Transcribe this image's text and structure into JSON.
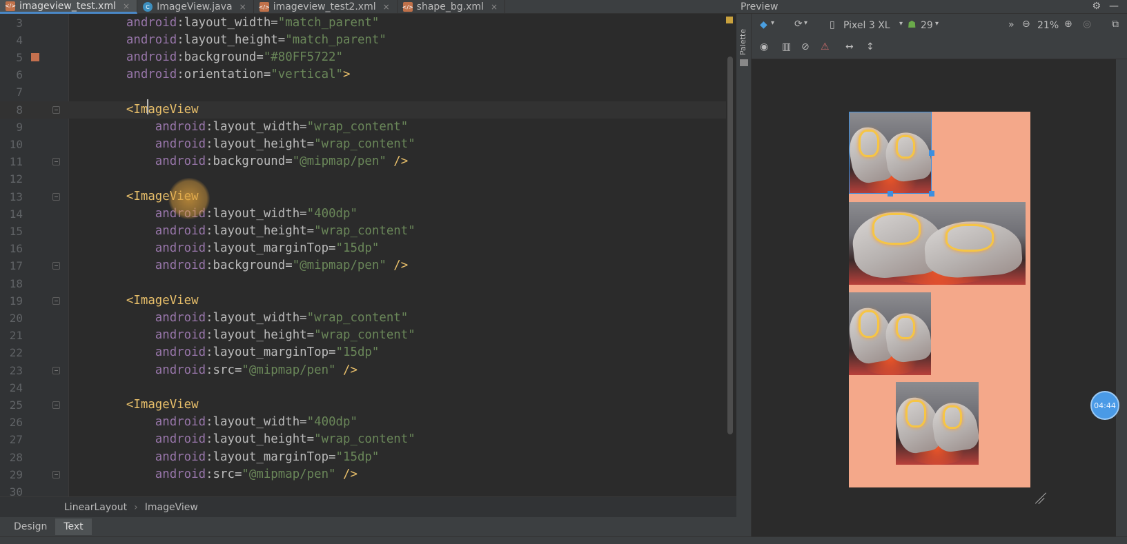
{
  "tabs": [
    {
      "label": "imageview_test.xml",
      "icon": "xml-file-icon",
      "active": true
    },
    {
      "label": "ImageView.java",
      "icon": "java-class-icon",
      "active": false
    },
    {
      "label": "imageview_test2.xml",
      "icon": "xml-file-icon",
      "active": false
    },
    {
      "label": "shape_bg.xml",
      "icon": "xml-file-icon",
      "active": false
    }
  ],
  "editor": {
    "lines": [
      {
        "num": "3",
        "indent": "    ",
        "parts": [
          {
            "c": "ns",
            "t": "android"
          },
          {
            "c": "attr",
            "t": ":layout_width="
          },
          {
            "c": "val",
            "t": "\"match_parent\""
          }
        ]
      },
      {
        "num": "4",
        "indent": "    ",
        "parts": [
          {
            "c": "ns",
            "t": "android"
          },
          {
            "c": "attr",
            "t": ":layout_height="
          },
          {
            "c": "val",
            "t": "\"match_parent\""
          }
        ]
      },
      {
        "num": "5",
        "indent": "    ",
        "parts": [
          {
            "c": "ns",
            "t": "android"
          },
          {
            "c": "attr",
            "t": ":background="
          },
          {
            "c": "val",
            "t": "\"#80FF5722\""
          }
        ]
      },
      {
        "num": "6",
        "indent": "    ",
        "parts": [
          {
            "c": "ns",
            "t": "android"
          },
          {
            "c": "attr",
            "t": ":orientation="
          },
          {
            "c": "val",
            "t": "\"vertical\""
          },
          {
            "c": "punct",
            "t": ">"
          }
        ]
      },
      {
        "num": "7",
        "indent": "",
        "parts": []
      },
      {
        "num": "8",
        "indent": "    ",
        "parts": [
          {
            "c": "punct",
            "t": "<"
          },
          {
            "c": "tag",
            "t": "ImageView"
          }
        ]
      },
      {
        "num": "9",
        "indent": "        ",
        "parts": [
          {
            "c": "ns",
            "t": "android"
          },
          {
            "c": "attr",
            "t": ":layout_width="
          },
          {
            "c": "val",
            "t": "\"wrap_content\""
          }
        ]
      },
      {
        "num": "10",
        "indent": "        ",
        "parts": [
          {
            "c": "ns",
            "t": "android"
          },
          {
            "c": "attr",
            "t": ":layout_height="
          },
          {
            "c": "val",
            "t": "\"wrap_content\""
          }
        ]
      },
      {
        "num": "11",
        "indent": "        ",
        "parts": [
          {
            "c": "ns",
            "t": "android"
          },
          {
            "c": "attr",
            "t": ":background="
          },
          {
            "c": "val",
            "t": "\"@mipmap/pen\""
          },
          {
            "c": "punct",
            "t": " />"
          }
        ]
      },
      {
        "num": "12",
        "indent": "",
        "parts": []
      },
      {
        "num": "13",
        "indent": "    ",
        "parts": [
          {
            "c": "punct",
            "t": "<"
          },
          {
            "c": "tag",
            "t": "ImageView"
          }
        ]
      },
      {
        "num": "14",
        "indent": "        ",
        "parts": [
          {
            "c": "ns",
            "t": "android"
          },
          {
            "c": "attr",
            "t": ":layout_width="
          },
          {
            "c": "val",
            "t": "\"400dp\""
          }
        ]
      },
      {
        "num": "15",
        "indent": "        ",
        "parts": [
          {
            "c": "ns",
            "t": "android"
          },
          {
            "c": "attr",
            "t": ":layout_height="
          },
          {
            "c": "val",
            "t": "\"wrap_content\""
          }
        ]
      },
      {
        "num": "16",
        "indent": "        ",
        "parts": [
          {
            "c": "ns",
            "t": "android"
          },
          {
            "c": "attr",
            "t": ":layout_marginTop="
          },
          {
            "c": "val",
            "t": "\"15dp\""
          }
        ]
      },
      {
        "num": "17",
        "indent": "        ",
        "parts": [
          {
            "c": "ns",
            "t": "android"
          },
          {
            "c": "attr",
            "t": ":background="
          },
          {
            "c": "val",
            "t": "\"@mipmap/pen\""
          },
          {
            "c": "punct",
            "t": " />"
          }
        ]
      },
      {
        "num": "18",
        "indent": "",
        "parts": []
      },
      {
        "num": "19",
        "indent": "    ",
        "parts": [
          {
            "c": "punct",
            "t": "<"
          },
          {
            "c": "tag",
            "t": "ImageView"
          }
        ]
      },
      {
        "num": "20",
        "indent": "        ",
        "parts": [
          {
            "c": "ns",
            "t": "android"
          },
          {
            "c": "attr",
            "t": ":layout_width="
          },
          {
            "c": "val",
            "t": "\"wrap_content\""
          }
        ]
      },
      {
        "num": "21",
        "indent": "        ",
        "parts": [
          {
            "c": "ns",
            "t": "android"
          },
          {
            "c": "attr",
            "t": ":layout_height="
          },
          {
            "c": "val",
            "t": "\"wrap_content\""
          }
        ]
      },
      {
        "num": "22",
        "indent": "        ",
        "parts": [
          {
            "c": "ns",
            "t": "android"
          },
          {
            "c": "attr",
            "t": ":layout_marginTop="
          },
          {
            "c": "val",
            "t": "\"15dp\""
          }
        ]
      },
      {
        "num": "23",
        "indent": "        ",
        "parts": [
          {
            "c": "ns",
            "t": "android"
          },
          {
            "c": "attr",
            "t": ":src="
          },
          {
            "c": "val",
            "t": "\"@mipmap/pen\""
          },
          {
            "c": "punct",
            "t": " />"
          }
        ]
      },
      {
        "num": "24",
        "indent": "",
        "parts": []
      },
      {
        "num": "25",
        "indent": "    ",
        "parts": [
          {
            "c": "punct",
            "t": "<"
          },
          {
            "c": "tag",
            "t": "ImageView"
          }
        ]
      },
      {
        "num": "26",
        "indent": "        ",
        "parts": [
          {
            "c": "ns",
            "t": "android"
          },
          {
            "c": "attr",
            "t": ":layout_width="
          },
          {
            "c": "val",
            "t": "\"400dp\""
          }
        ]
      },
      {
        "num": "27",
        "indent": "        ",
        "parts": [
          {
            "c": "ns",
            "t": "android"
          },
          {
            "c": "attr",
            "t": ":layout_height="
          },
          {
            "c": "val",
            "t": "\"wrap_content\""
          }
        ]
      },
      {
        "num": "28",
        "indent": "        ",
        "parts": [
          {
            "c": "ns",
            "t": "android"
          },
          {
            "c": "attr",
            "t": ":layout_marginTop="
          },
          {
            "c": "val",
            "t": "\"15dp\""
          }
        ]
      },
      {
        "num": "29",
        "indent": "        ",
        "parts": [
          {
            "c": "ns",
            "t": "android"
          },
          {
            "c": "attr",
            "t": ":src="
          },
          {
            "c": "val",
            "t": "\"@mipmap/pen\""
          },
          {
            "c": "punct",
            "t": " />"
          }
        ]
      },
      {
        "num": "30",
        "indent": "",
        "parts": []
      }
    ],
    "current_line": "8",
    "bookmark_line": "5",
    "fold_lines": [
      "8",
      "11",
      "13",
      "17",
      "19",
      "23",
      "25",
      "29"
    ]
  },
  "breadcrumb": [
    "LinearLayout",
    "ImageView"
  ],
  "bottom_tabs": {
    "design": "Design",
    "text": "Text",
    "active": "Text"
  },
  "preview": {
    "title": "Preview",
    "palette_label": "Palette",
    "device": "Pixel 3 XL",
    "api_level": "29",
    "zoom": "21%",
    "background_color": "#f4a88a",
    "timer": "04:44"
  },
  "icons": {
    "layers": "◆",
    "rotate": "⟳",
    "device": "▯",
    "android": "☗",
    "more": "»",
    "zoom_out": "⊖",
    "zoom_in": "⊕",
    "zoom_reset": "◎",
    "fit": "⧉",
    "eye": "◉",
    "blueprint": "▥",
    "magnet": "⊘",
    "warning": "⚠",
    "expand_h": "↔",
    "expand_v": "↕",
    "gear": "⚙",
    "minimize": "—",
    "close_tab": "×"
  }
}
